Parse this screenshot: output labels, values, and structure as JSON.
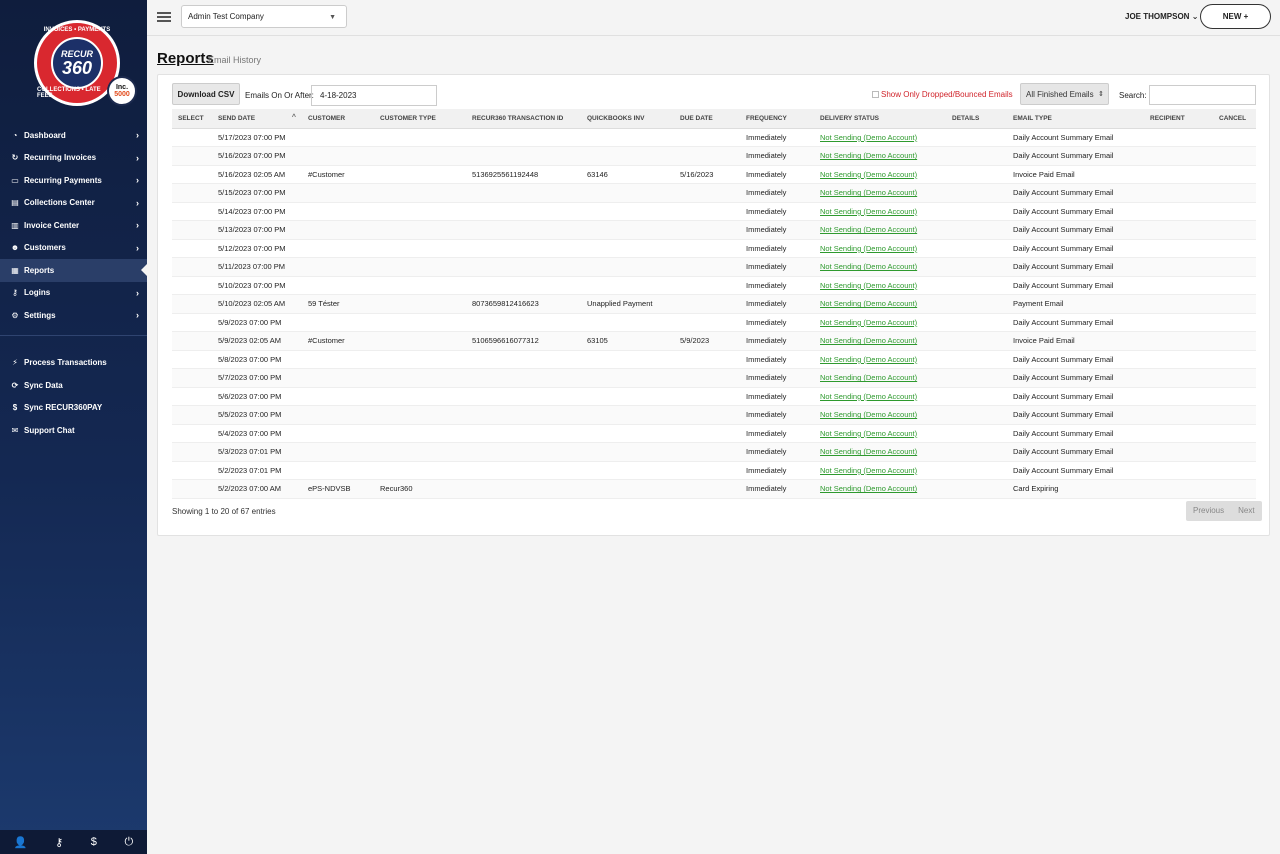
{
  "logo": {
    "top": "RECUR",
    "main": "360",
    "ring_top": "INVOICES • PAYMENTS",
    "ring_bottom": "COLLECTIONS • LATE FEES",
    "inc_top": "Inc.",
    "inc_num": "5000"
  },
  "sidebar": {
    "items": [
      {
        "label": "Dashboard",
        "icon": "dashboard-icon",
        "glyph": "◔",
        "chevron": true
      },
      {
        "label": "Recurring Invoices",
        "icon": "refresh-icon",
        "glyph": "↻",
        "chevron": true
      },
      {
        "label": "Recurring Payments",
        "icon": "credit-card-icon",
        "glyph": "▭",
        "chevron": true
      },
      {
        "label": "Collections Center",
        "icon": "document-icon",
        "glyph": "▤",
        "chevron": true
      },
      {
        "label": "Invoice Center",
        "icon": "file-icon",
        "glyph": "▥",
        "chevron": true
      },
      {
        "label": "Customers",
        "icon": "users-icon",
        "glyph": "☻",
        "chevron": true
      },
      {
        "label": "Reports",
        "icon": "bar-chart-icon",
        "glyph": "▦",
        "chevron": false,
        "active": true
      },
      {
        "label": "Logins",
        "icon": "key-icon",
        "glyph": "⚷",
        "chevron": true
      },
      {
        "label": "Settings",
        "icon": "gears-icon",
        "glyph": "⚙",
        "chevron": true
      }
    ],
    "extra": [
      {
        "label": "Process Transactions",
        "icon": "bolt-icon",
        "glyph": "⚡"
      },
      {
        "label": "Sync Data",
        "icon": "sync-icon",
        "glyph": "⟳"
      },
      {
        "label": "Sync RECUR360PAY",
        "icon": "dollar-icon",
        "glyph": "$"
      },
      {
        "label": "Support Chat",
        "icon": "chat-icon",
        "glyph": "✉"
      }
    ],
    "bottom_icons": [
      {
        "name": "user-icon",
        "glyph": "👤"
      },
      {
        "name": "key-icon",
        "glyph": "⚷"
      },
      {
        "name": "dollar-icon",
        "glyph": "$"
      },
      {
        "name": "power-icon",
        "glyph": "⏻"
      }
    ]
  },
  "topbar": {
    "company": "Admin Test Company",
    "user": "JOE THOMPSON",
    "user_caret": "⌄",
    "new_label": "NEW +"
  },
  "page": {
    "title": "Reports",
    "subtitle": "Email History"
  },
  "toolbar": {
    "download_label": "Download CSV",
    "date_label": "Emails On Or After:",
    "date_value": "4-18-2023",
    "dropped_label": "Show Only Dropped/Bounced Emails",
    "filter_value": "All Finished Emails",
    "search_label": "Search:"
  },
  "table": {
    "columns": [
      "SELECT",
      "SEND DATE",
      "CUSTOMER",
      "CUSTOMER TYPE",
      "RECUR360 TRANSACTION ID",
      "QUICKBOOKS INV",
      "DUE DATE",
      "FREQUENCY",
      "DELIVERY STATUS",
      "DETAILS",
      "EMAIL TYPE",
      "RECIPIENT",
      "CANCEL"
    ],
    "rows": [
      {
        "send_date": "5/17/2023 07:00 PM",
        "customer": "",
        "customer_type": "",
        "txn": "",
        "qb": "",
        "due": "",
        "freq": "Immediately",
        "status": "Not Sending (Demo Account)",
        "type": "Daily Account Summary Email"
      },
      {
        "send_date": "5/16/2023 07:00 PM",
        "customer": "",
        "customer_type": "",
        "txn": "",
        "qb": "",
        "due": "",
        "freq": "Immediately",
        "status": "Not Sending (Demo Account)",
        "type": "Daily Account Summary Email"
      },
      {
        "send_date": "5/16/2023 02:05 AM",
        "customer": "#Customer",
        "customer_type": "",
        "txn": "5136925561192448",
        "qb": "63146",
        "due": "5/16/2023",
        "freq": "Immediately",
        "status": "Not Sending (Demo Account)",
        "type": "Invoice Paid Email"
      },
      {
        "send_date": "5/15/2023 07:00 PM",
        "customer": "",
        "customer_type": "",
        "txn": "",
        "qb": "",
        "due": "",
        "freq": "Immediately",
        "status": "Not Sending (Demo Account)",
        "type": "Daily Account Summary Email"
      },
      {
        "send_date": "5/14/2023 07:00 PM",
        "customer": "",
        "customer_type": "",
        "txn": "",
        "qb": "",
        "due": "",
        "freq": "Immediately",
        "status": "Not Sending (Demo Account)",
        "type": "Daily Account Summary Email"
      },
      {
        "send_date": "5/13/2023 07:00 PM",
        "customer": "",
        "customer_type": "",
        "txn": "",
        "qb": "",
        "due": "",
        "freq": "Immediately",
        "status": "Not Sending (Demo Account)",
        "type": "Daily Account Summary Email"
      },
      {
        "send_date": "5/12/2023 07:00 PM",
        "customer": "",
        "customer_type": "",
        "txn": "",
        "qb": "",
        "due": "",
        "freq": "Immediately",
        "status": "Not Sending (Demo Account)",
        "type": "Daily Account Summary Email"
      },
      {
        "send_date": "5/11/2023 07:00 PM",
        "customer": "",
        "customer_type": "",
        "txn": "",
        "qb": "",
        "due": "",
        "freq": "Immediately",
        "status": "Not Sending (Demo Account)",
        "type": "Daily Account Summary Email"
      },
      {
        "send_date": "5/10/2023 07:00 PM",
        "customer": "",
        "customer_type": "",
        "txn": "",
        "qb": "",
        "due": "",
        "freq": "Immediately",
        "status": "Not Sending (Demo Account)",
        "type": "Daily Account Summary Email"
      },
      {
        "send_date": "5/10/2023 02:05 AM",
        "customer": "59 Téster",
        "customer_type": "",
        "txn": "8073659812416623",
        "qb": "Unapplied Payment",
        "due": "",
        "freq": "Immediately",
        "status": "Not Sending (Demo Account)",
        "type": "Payment Email"
      },
      {
        "send_date": "5/9/2023 07:00 PM",
        "customer": "",
        "customer_type": "",
        "txn": "",
        "qb": "",
        "due": "",
        "freq": "Immediately",
        "status": "Not Sending (Demo Account)",
        "type": "Daily Account Summary Email"
      },
      {
        "send_date": "5/9/2023 02:05 AM",
        "customer": "#Customer",
        "customer_type": "",
        "txn": "5106596616077312",
        "qb": "63105",
        "due": "5/9/2023",
        "freq": "Immediately",
        "status": "Not Sending (Demo Account)",
        "type": "Invoice Paid Email"
      },
      {
        "send_date": "5/8/2023 07:00 PM",
        "customer": "",
        "customer_type": "",
        "txn": "",
        "qb": "",
        "due": "",
        "freq": "Immediately",
        "status": "Not Sending (Demo Account)",
        "type": "Daily Account Summary Email"
      },
      {
        "send_date": "5/7/2023 07:00 PM",
        "customer": "",
        "customer_type": "",
        "txn": "",
        "qb": "",
        "due": "",
        "freq": "Immediately",
        "status": "Not Sending (Demo Account)",
        "type": "Daily Account Summary Email"
      },
      {
        "send_date": "5/6/2023 07:00 PM",
        "customer": "",
        "customer_type": "",
        "txn": "",
        "qb": "",
        "due": "",
        "freq": "Immediately",
        "status": "Not Sending (Demo Account)",
        "type": "Daily Account Summary Email"
      },
      {
        "send_date": "5/5/2023 07:00 PM",
        "customer": "",
        "customer_type": "",
        "txn": "",
        "qb": "",
        "due": "",
        "freq": "Immediately",
        "status": "Not Sending (Demo Account)",
        "type": "Daily Account Summary Email"
      },
      {
        "send_date": "5/4/2023 07:00 PM",
        "customer": "",
        "customer_type": "",
        "txn": "",
        "qb": "",
        "due": "",
        "freq": "Immediately",
        "status": "Not Sending (Demo Account)",
        "type": "Daily Account Summary Email"
      },
      {
        "send_date": "5/3/2023 07:01 PM",
        "customer": "",
        "customer_type": "",
        "txn": "",
        "qb": "",
        "due": "",
        "freq": "Immediately",
        "status": "Not Sending (Demo Account)",
        "type": "Daily Account Summary Email"
      },
      {
        "send_date": "5/2/2023 07:01 PM",
        "customer": "",
        "customer_type": "",
        "txn": "",
        "qb": "",
        "due": "",
        "freq": "Immediately",
        "status": "Not Sending (Demo Account)",
        "type": "Daily Account Summary Email"
      },
      {
        "send_date": "5/2/2023 07:00 AM",
        "customer": "ePS-NDVSB",
        "customer_type": "Recur360",
        "txn": "",
        "qb": "",
        "due": "",
        "freq": "Immediately",
        "status": "Not Sending (Demo Account)",
        "type": "Card Expiring"
      }
    ]
  },
  "footer": {
    "showing": "Showing 1 to 20 of 67 entries",
    "prev": "Previous",
    "next": "Next"
  }
}
